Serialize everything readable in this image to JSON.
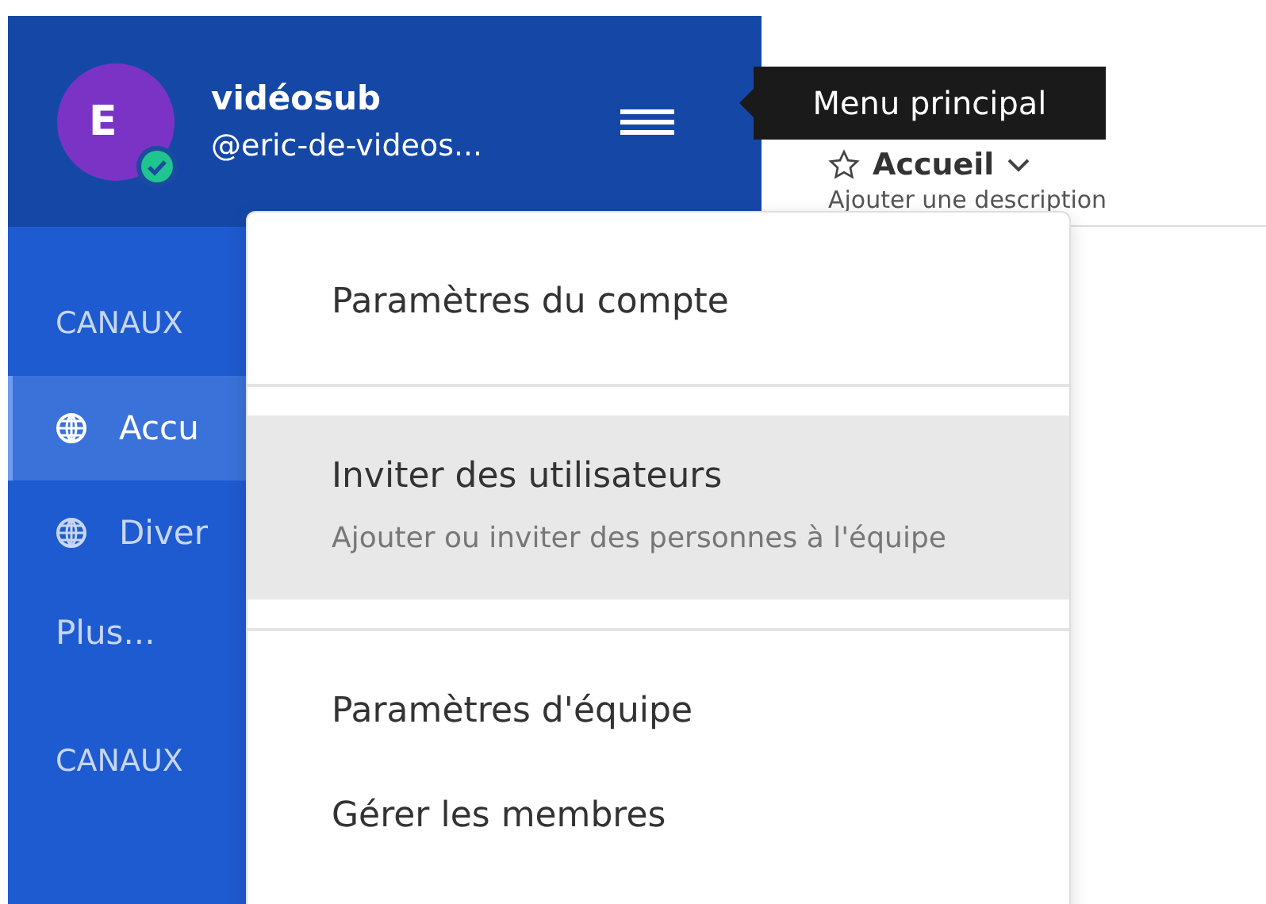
{
  "sidebar": {
    "header": {
      "avatar_letter": "E",
      "name": "vidéosub",
      "handle": "@eric-de-videos...",
      "verified": true
    },
    "sections": [
      {
        "title": "CANAUX",
        "items": [
          {
            "label": "Accu",
            "selected": true
          },
          {
            "label": "Diver",
            "selected": false
          }
        ],
        "more": "Plus..."
      },
      {
        "title": "CANAUX"
      }
    ]
  },
  "tooltip": {
    "text": "Menu principal"
  },
  "channel": {
    "title": "Accueil",
    "description": "Ajouter une description"
  },
  "menu": {
    "items": [
      {
        "label": "Paramètres du compte",
        "selected": false,
        "divider_after": true
      },
      {
        "label": "Inviter des utilisateurs",
        "description": "Ajouter ou inviter des personnes à l'équipe",
        "selected": true,
        "divider_after": true
      },
      {
        "label": "Paramètres d'équipe",
        "selected": false,
        "divider_after": false
      },
      {
        "label": "Gérer les membres",
        "selected": false,
        "divider_after": false
      }
    ]
  }
}
